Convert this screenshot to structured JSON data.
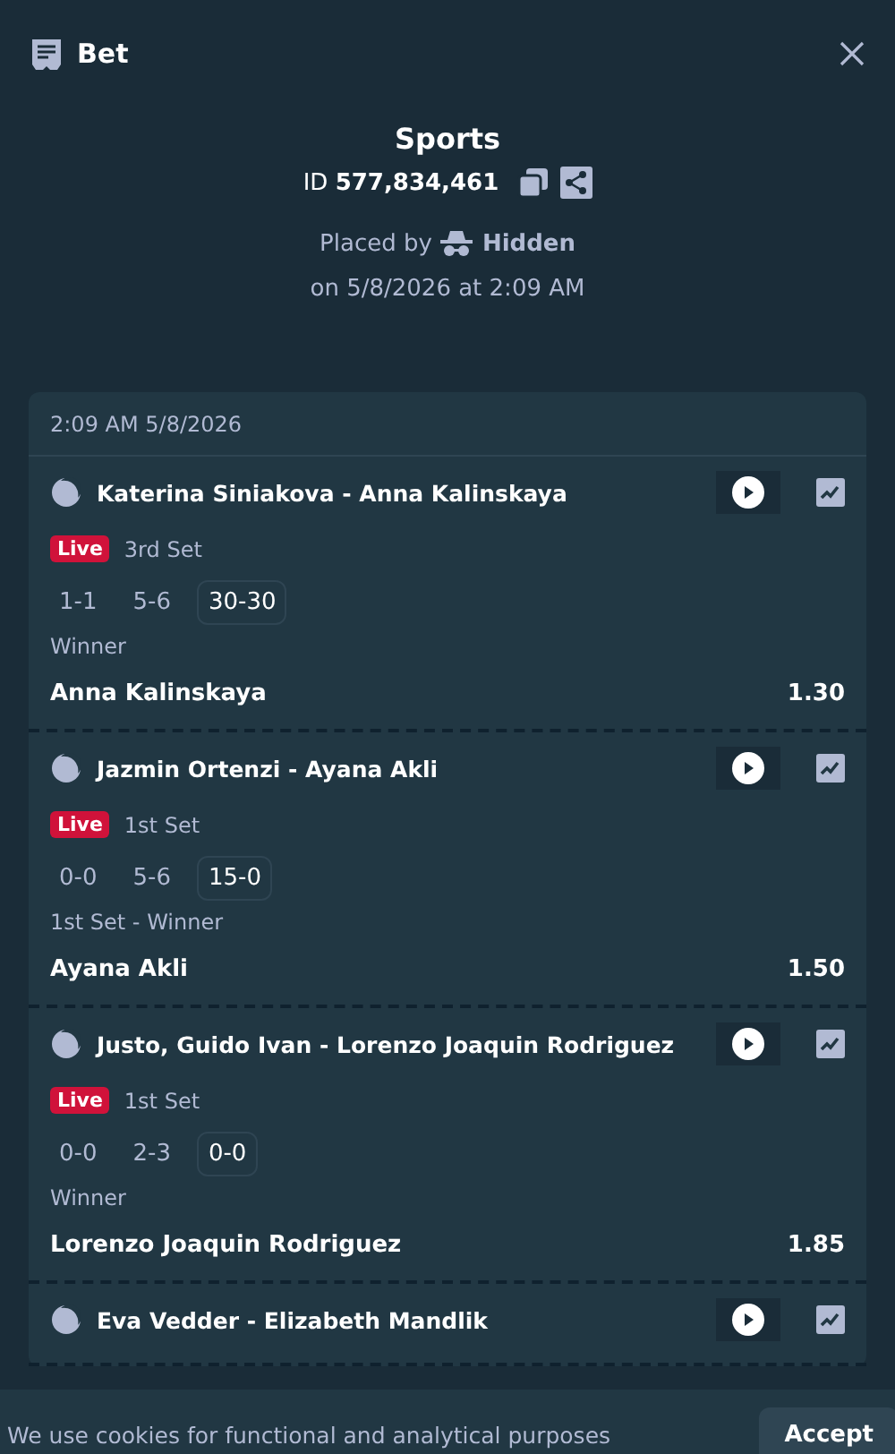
{
  "header": {
    "title": "Bet"
  },
  "summary": {
    "title": "Sports",
    "id_label": "ID",
    "id_value": "577,834,461",
    "placed_by": "Placed by",
    "user": "Hidden",
    "placed_on": "on 5/8/2026 at 2:09 AM"
  },
  "card": {
    "timestamp": "2:09 AM 5/8/2026",
    "legs": [
      {
        "event": "Katerina Siniakova - Anna Kalinskaya",
        "live": "Live",
        "period": "3rd Set",
        "scores": [
          {
            "text": "1-1",
            "current": false
          },
          {
            "text": "5-6",
            "current": false
          },
          {
            "text": "30-30",
            "current": true
          }
        ],
        "market": "Winner",
        "selection": "Anna Kalinskaya",
        "odds": "1.30"
      },
      {
        "event": "Jazmin Ortenzi - Ayana Akli",
        "live": "Live",
        "period": "1st Set",
        "scores": [
          {
            "text": "0-0",
            "current": false
          },
          {
            "text": "5-6",
            "current": false
          },
          {
            "text": "15-0",
            "current": true
          }
        ],
        "market": "1st Set - Winner",
        "selection": "Ayana Akli",
        "odds": "1.50"
      },
      {
        "event": "Justo, Guido Ivan - Lorenzo Joaquin Rodriguez",
        "live": "Live",
        "period": "1st Set",
        "scores": [
          {
            "text": "0-0",
            "current": false
          },
          {
            "text": "2-3",
            "current": false
          },
          {
            "text": "0-0",
            "current": true
          }
        ],
        "market": "Winner",
        "selection": "Lorenzo Joaquin Rodriguez",
        "odds": "1.85"
      },
      {
        "event": "Eva Vedder - Elizabeth Mandlik"
      }
    ]
  },
  "cookie_banner": {
    "text": "We use cookies for functional and analytical purposes",
    "button": "Accept"
  }
}
